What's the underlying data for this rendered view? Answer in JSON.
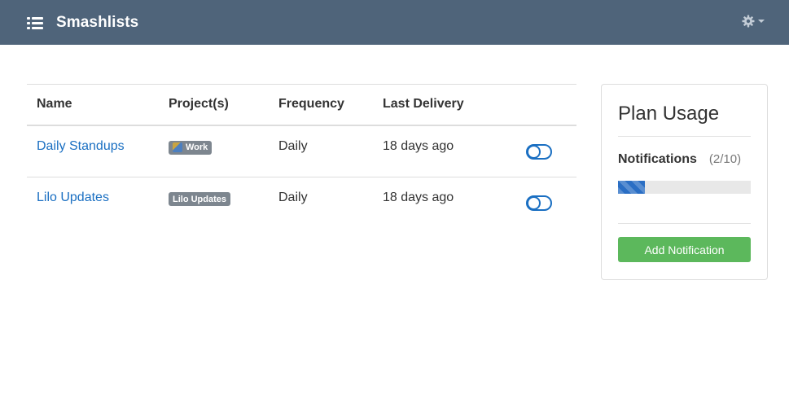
{
  "app": {
    "title": "Smashlists"
  },
  "header": {
    "menu_icon": "list-icon",
    "settings_icon": "gear-icon",
    "nav_color": "#4f647a"
  },
  "table": {
    "columns": [
      "Name",
      "Project(s)",
      "Frequency",
      "Last Delivery"
    ],
    "rows": [
      {
        "name": "Daily Standups",
        "project": "Work",
        "project_has_logo": true,
        "frequency": "Daily",
        "last_delivery": "18 days ago",
        "enabled": true
      },
      {
        "name": "Lilo Updates",
        "project": "Lilo Updates",
        "project_has_logo": false,
        "frequency": "Daily",
        "last_delivery": "18 days ago",
        "enabled": true
      }
    ]
  },
  "plan": {
    "title": "Plan Usage",
    "label": "Notifications",
    "count": "(2/10)",
    "used": 2,
    "limit": 10,
    "button_label": "Add Notification",
    "bar_color": "#2a6ec4",
    "button_color": "#5cb85c"
  }
}
